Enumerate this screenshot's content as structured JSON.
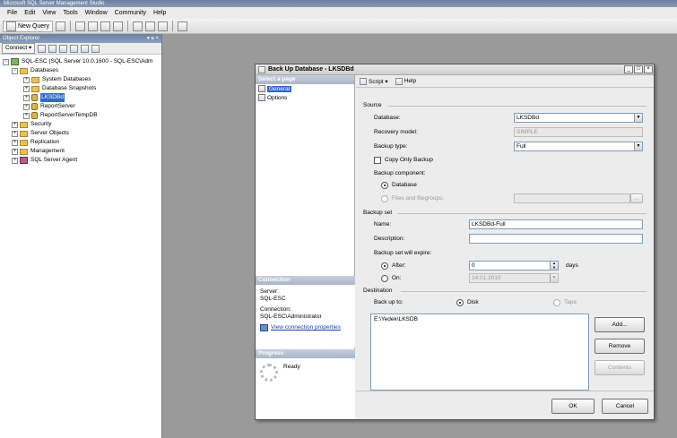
{
  "app": {
    "title": "Microsoft SQL Server Management Studio"
  },
  "menu": [
    "File",
    "Edit",
    "View",
    "Tools",
    "Window",
    "Community",
    "Help"
  ],
  "toolbar": {
    "new_query": "New Query"
  },
  "object_explorer": {
    "title": "Object Explorer",
    "pin": "▾ ᵾ ×",
    "connect": "Connect ▾",
    "tree": {
      "server": "SQL-ESC (SQL Server 10.0.1600 - SQL-ESC\\Adm",
      "databases": "Databases",
      "system_databases": "System Databases",
      "database_snapshots": "Database Snapshots",
      "lksdbd": "LKSDBd",
      "reportserver": "ReportServer",
      "reportservertempdb": "ReportServerTempDB",
      "security": "Security",
      "server_objects": "Server Objects",
      "replication": "Replication",
      "management": "Management",
      "sql_agent": "SQL Server Agent"
    }
  },
  "dialog": {
    "title": "Back Up Database - LKSDBd",
    "select_page": "Select a page",
    "pages": [
      "General",
      "Options"
    ],
    "toolbar": {
      "script": "Script ▾",
      "help": "Help"
    },
    "connection": {
      "head": "Connection",
      "server_label": "Server:",
      "server_value": "SQL-ESC",
      "connection_label": "Connection:",
      "connection_value": "SQL-ESC\\Administrator",
      "link": "View connection properties"
    },
    "progress": {
      "head": "Progress",
      "status": "Ready"
    },
    "source": {
      "head": "Source",
      "database_label": "Database:",
      "database_value": "LKSDBd",
      "recovery_label": "Recovery model:",
      "recovery_value": "SIMPLE",
      "backup_type_label": "Backup type:",
      "backup_type_value": "Full",
      "copy_only": "Copy Only Backup",
      "component_label": "Backup component:",
      "component_database": "Database",
      "component_files": "Files and filegroups:"
    },
    "backup_set": {
      "head": "Backup set",
      "name_label": "Name:",
      "name_value": "LKSDBd-Full",
      "description_label": "Description:",
      "description_value": "",
      "expire_label": "Backup set will expire:",
      "after_label": "After:",
      "after_value": "0",
      "days": "days",
      "on_label": "On:",
      "on_value": "14.01.2010"
    },
    "destination": {
      "head": "Destination",
      "backup_to_label": "Back up to:",
      "disk": "Disk",
      "tape": "Tape",
      "paths": [
        "E:\\Yedek\\LKSDB"
      ],
      "add": "Add...",
      "remove": "Remove",
      "contents": "Contents"
    },
    "ok": "OK",
    "cancel": "Cancel"
  }
}
